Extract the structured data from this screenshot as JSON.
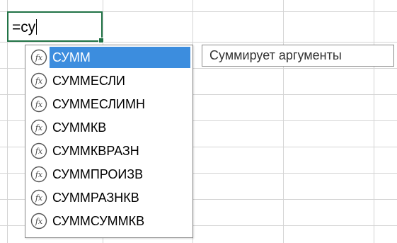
{
  "cell": {
    "formula_text": "=су"
  },
  "autocomplete": {
    "items": [
      {
        "label": "СУММ",
        "selected": true,
        "icon": "function-icon"
      },
      {
        "label": "СУММЕСЛИ",
        "selected": false,
        "icon": "function-icon"
      },
      {
        "label": "СУММЕСЛИМН",
        "selected": false,
        "icon": "function-icon"
      },
      {
        "label": "СУММКВ",
        "selected": false,
        "icon": "function-icon"
      },
      {
        "label": "СУММКВРАЗН",
        "selected": false,
        "icon": "function-icon"
      },
      {
        "label": "СУММПРОИЗВ",
        "selected": false,
        "icon": "function-icon"
      },
      {
        "label": "СУММРАЗНКВ",
        "selected": false,
        "icon": "function-icon"
      },
      {
        "label": "СУММСУММКВ",
        "selected": false,
        "icon": "function-icon"
      }
    ]
  },
  "tooltip": {
    "text": "Суммирует аргументы"
  },
  "colors": {
    "selection": "#3c8dde",
    "active_cell_border": "#217346",
    "gridline": "#d4d4d4"
  }
}
